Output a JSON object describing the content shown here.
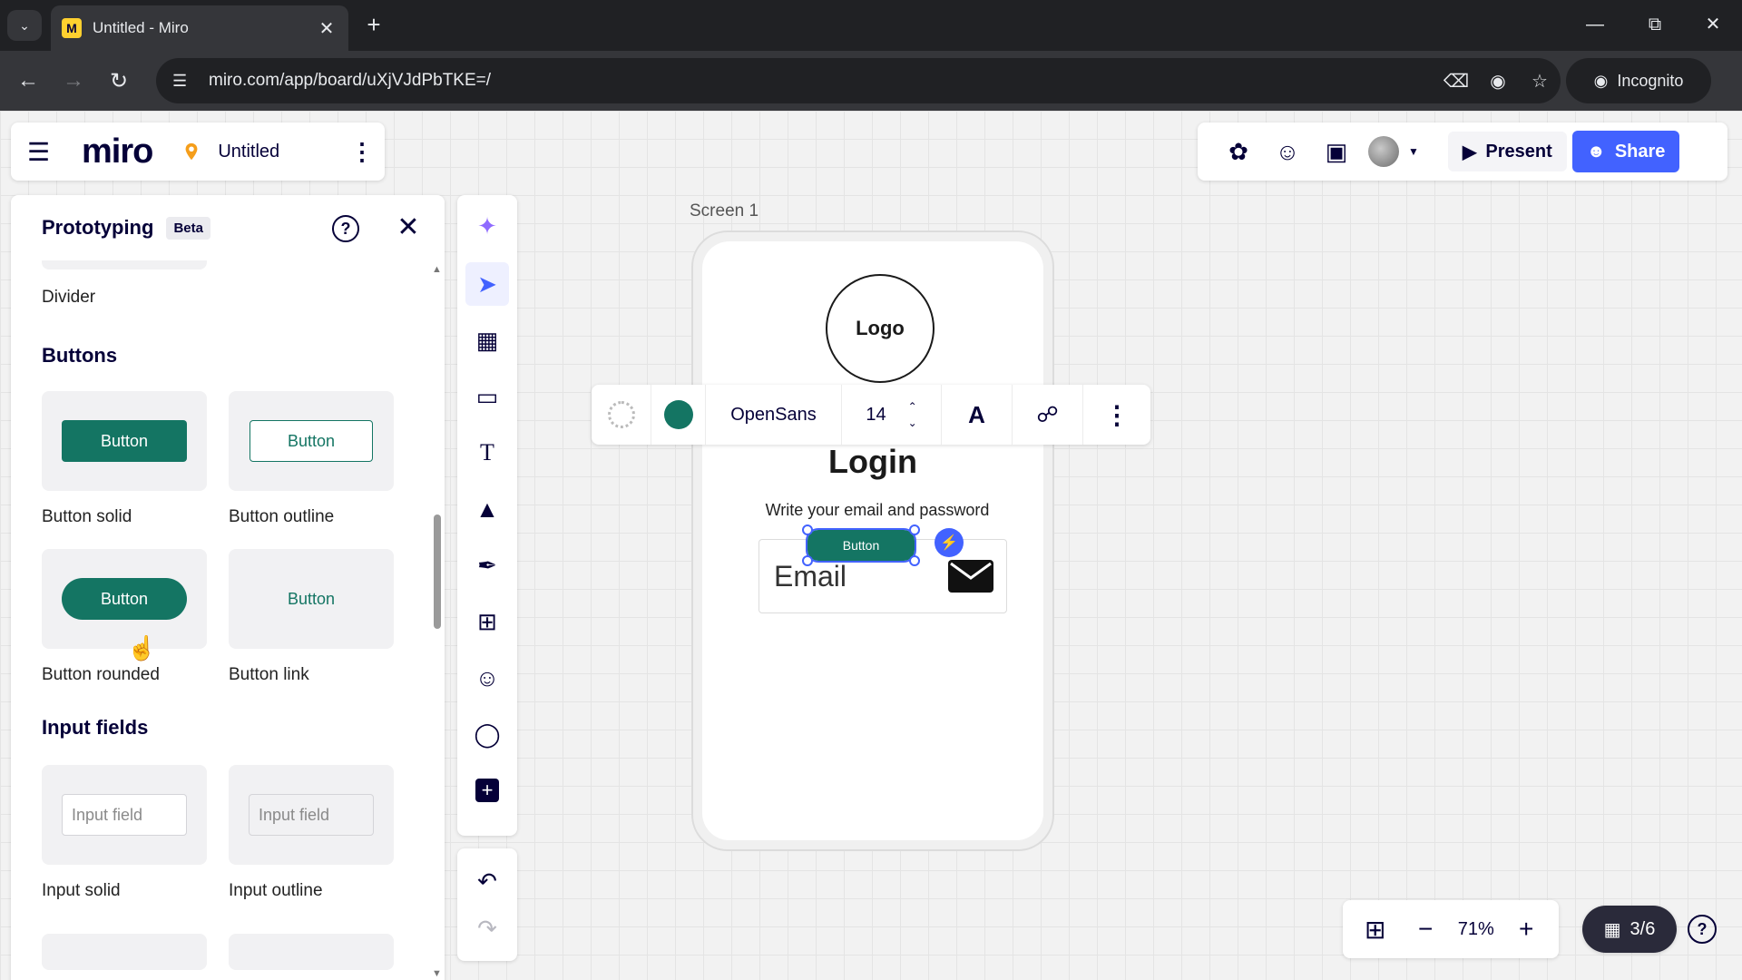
{
  "browser": {
    "tab_title": "Untitled - Miro",
    "tab_favicon": "M",
    "url": "miro.com/app/board/uXjVJdPbTKE=/",
    "incognito_label": "Incognito"
  },
  "board": {
    "logo": "miro",
    "name": "Untitled"
  },
  "topbar": {
    "present_label": "Present",
    "share_label": "Share",
    "accent_color": "#4262ff"
  },
  "panel": {
    "title": "Prototyping",
    "badge": "Beta",
    "divider_label": "Divider",
    "sections": {
      "buttons": {
        "title": "Buttons",
        "items": [
          {
            "preview": "Button",
            "caption": "Button solid"
          },
          {
            "preview": "Button",
            "caption": "Button outline"
          },
          {
            "preview": "Button",
            "caption": "Button rounded"
          },
          {
            "preview": "Button",
            "caption": "Button link"
          }
        ]
      },
      "inputs": {
        "title": "Input fields",
        "items": [
          {
            "preview": "Input field",
            "caption": "Input solid"
          },
          {
            "preview": "Input field",
            "caption": "Input outline"
          }
        ]
      }
    },
    "primary_color": "#147563"
  },
  "frame": {
    "label": "Screen 1",
    "logo_text": "Logo",
    "title": "Login",
    "subtitle": "Write your email and password",
    "email_placeholder": "Email",
    "selected_button_label": "Button"
  },
  "context_toolbar": {
    "font": "OpenSans",
    "font_size": "14",
    "text_color": "#147563"
  },
  "zoom": {
    "level": "71%",
    "pages": "3/6"
  }
}
